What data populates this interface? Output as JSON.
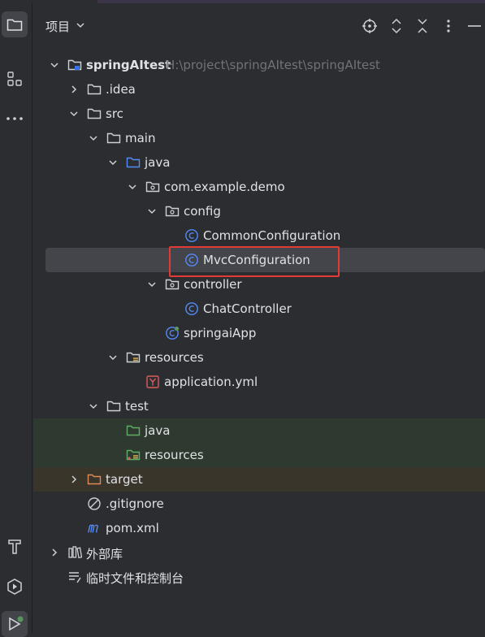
{
  "panel": {
    "title": "项目"
  },
  "tree": {
    "items": [
      {
        "label": "springAItest",
        "path": "H:\\project\\springAItest\\springAItest"
      },
      {
        "label": ".idea"
      },
      {
        "label": "src"
      },
      {
        "label": "main"
      },
      {
        "label": "java"
      },
      {
        "label": "com.example.demo"
      },
      {
        "label": "config"
      },
      {
        "label": "CommonConfiguration"
      },
      {
        "label": "MvcConfiguration"
      },
      {
        "label": "controller"
      },
      {
        "label": "ChatController"
      },
      {
        "label": "springaiApp"
      },
      {
        "label": "resources"
      },
      {
        "label": "application.yml"
      },
      {
        "label": "test"
      },
      {
        "label": "java"
      },
      {
        "label": "resources"
      },
      {
        "label": "target"
      },
      {
        "label": ".gitignore"
      },
      {
        "label": "pom.xml"
      },
      {
        "label": "外部库"
      },
      {
        "label": "临时文件和控制台"
      }
    ]
  },
  "colors": {
    "highlight": "#e53935",
    "java_class": "#3574f0",
    "selected_row": "#43454a"
  }
}
